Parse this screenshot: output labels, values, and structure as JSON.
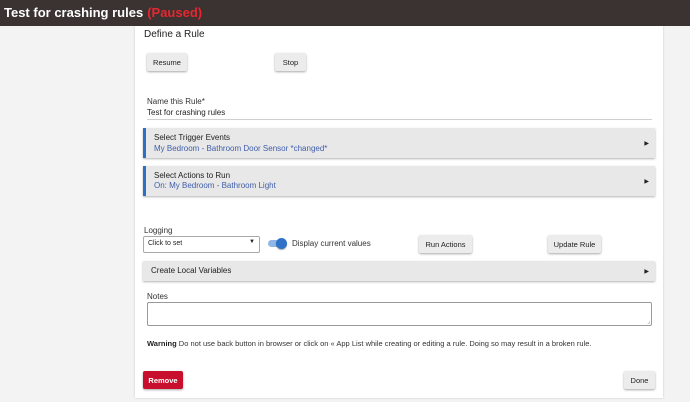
{
  "header": {
    "title": "Test for crashing rules",
    "status": "(Paused)",
    "status_color": "#e8262f"
  },
  "rule": {
    "heading": "Define a Rule",
    "resume_label": "Resume",
    "stop_label": "Stop",
    "name_label": "Name this Rule*",
    "name_value": "Test for crashing rules"
  },
  "triggers": {
    "title": "Select Trigger Events",
    "summary": "My Bedroom - Bathroom Door Sensor *changed*"
  },
  "actions": {
    "title": "Select Actions to Run",
    "summary": "On: My Bedroom - Bathroom Light"
  },
  "logging": {
    "label": "Logging",
    "select_value": "Click to set",
    "toggle_label": "Display current values",
    "toggle_on": true
  },
  "buttons": {
    "run_actions": "Run Actions",
    "update_rule": "Update Rule",
    "remove": "Remove",
    "done": "Done"
  },
  "local_variables": {
    "title": "Create Local Variables"
  },
  "notes": {
    "label": "Notes",
    "value": ""
  },
  "warning": {
    "prefix": "Warning",
    "text": " Do not use back button in browser or click on « App List while creating or editing a rule. Doing so may result in a broken rule."
  },
  "colors": {
    "topbar": "#3a3331",
    "accent": "#2d6fc5",
    "remove_button": "#c8102e",
    "link_text": "#3f5eaa"
  },
  "icons": {
    "expand": "right-triangle",
    "dropdown": "down-triangle",
    "resize": "resize-grip"
  }
}
